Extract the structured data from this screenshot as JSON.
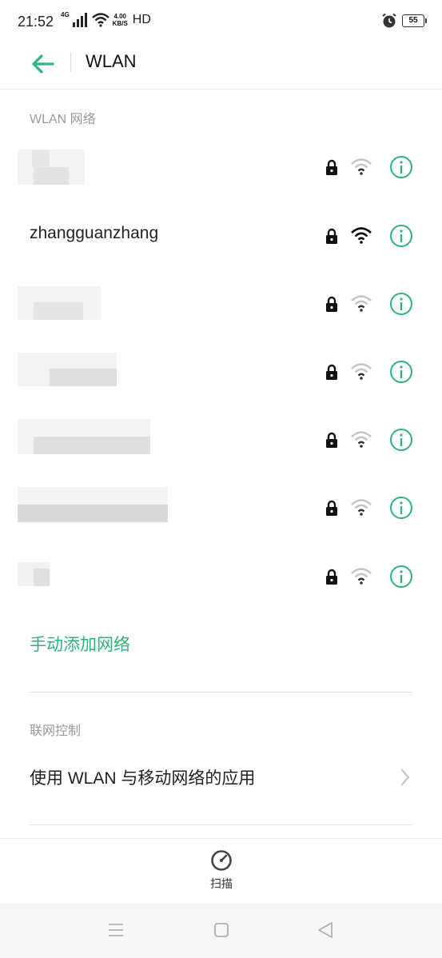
{
  "status_bar": {
    "time": "21:52",
    "network_type": "4G",
    "speed_value": "4.00",
    "speed_unit": "KB/S",
    "hd": "HD",
    "battery": "55"
  },
  "app_bar": {
    "title": "WLAN",
    "back_icon": "arrow-left-icon"
  },
  "wlan_section": {
    "label": "WLAN 网络",
    "networks": [
      {
        "name": "",
        "hidden": true,
        "secured": true,
        "signal": "weak"
      },
      {
        "name": "zhangguanzhang",
        "hidden": false,
        "secured": true,
        "signal": "strong"
      },
      {
        "name": "",
        "hidden": true,
        "secured": true,
        "signal": "weak"
      },
      {
        "name": "",
        "hidden": true,
        "secured": true,
        "signal": "weak"
      },
      {
        "name": "",
        "hidden": true,
        "secured": true,
        "signal": "weak"
      },
      {
        "name": "",
        "hidden": true,
        "secured": true,
        "signal": "weak"
      },
      {
        "name": "",
        "hidden": true,
        "secured": true,
        "signal": "weak"
      }
    ]
  },
  "manual_add": "手动添加网络",
  "network_control": {
    "label": "联网控制",
    "item": "使用 WLAN 与移动网络的应用"
  },
  "bottom": {
    "scan_label": "扫描",
    "scan_icon": "gauge-icon"
  },
  "nav": {
    "menu_icon": "menu-icon",
    "home_icon": "square-icon",
    "back_icon": "triangle-back-icon"
  },
  "colors": {
    "accent": "#2fb37a",
    "section_label": "#9a9a9a"
  }
}
